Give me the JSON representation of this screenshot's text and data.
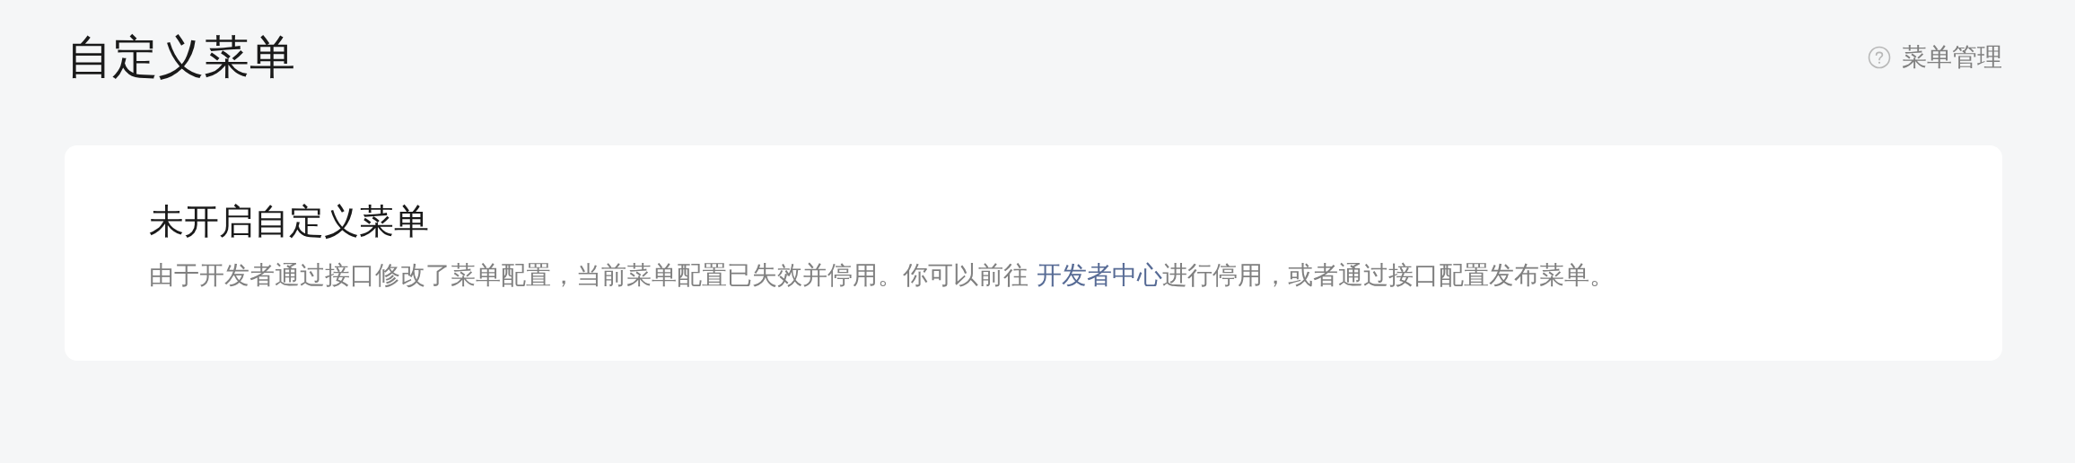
{
  "page": {
    "title": "自定义菜单",
    "help_link": "菜单管理"
  },
  "notice": {
    "title": "未开启自定义菜单",
    "text_before": "由于开发者通过接口修改了菜单配置，当前菜单配置已失效并停用。你可以前往 ",
    "link": "开发者中心",
    "text_after": "进行停用，或者通过接口配置发布菜单。"
  }
}
